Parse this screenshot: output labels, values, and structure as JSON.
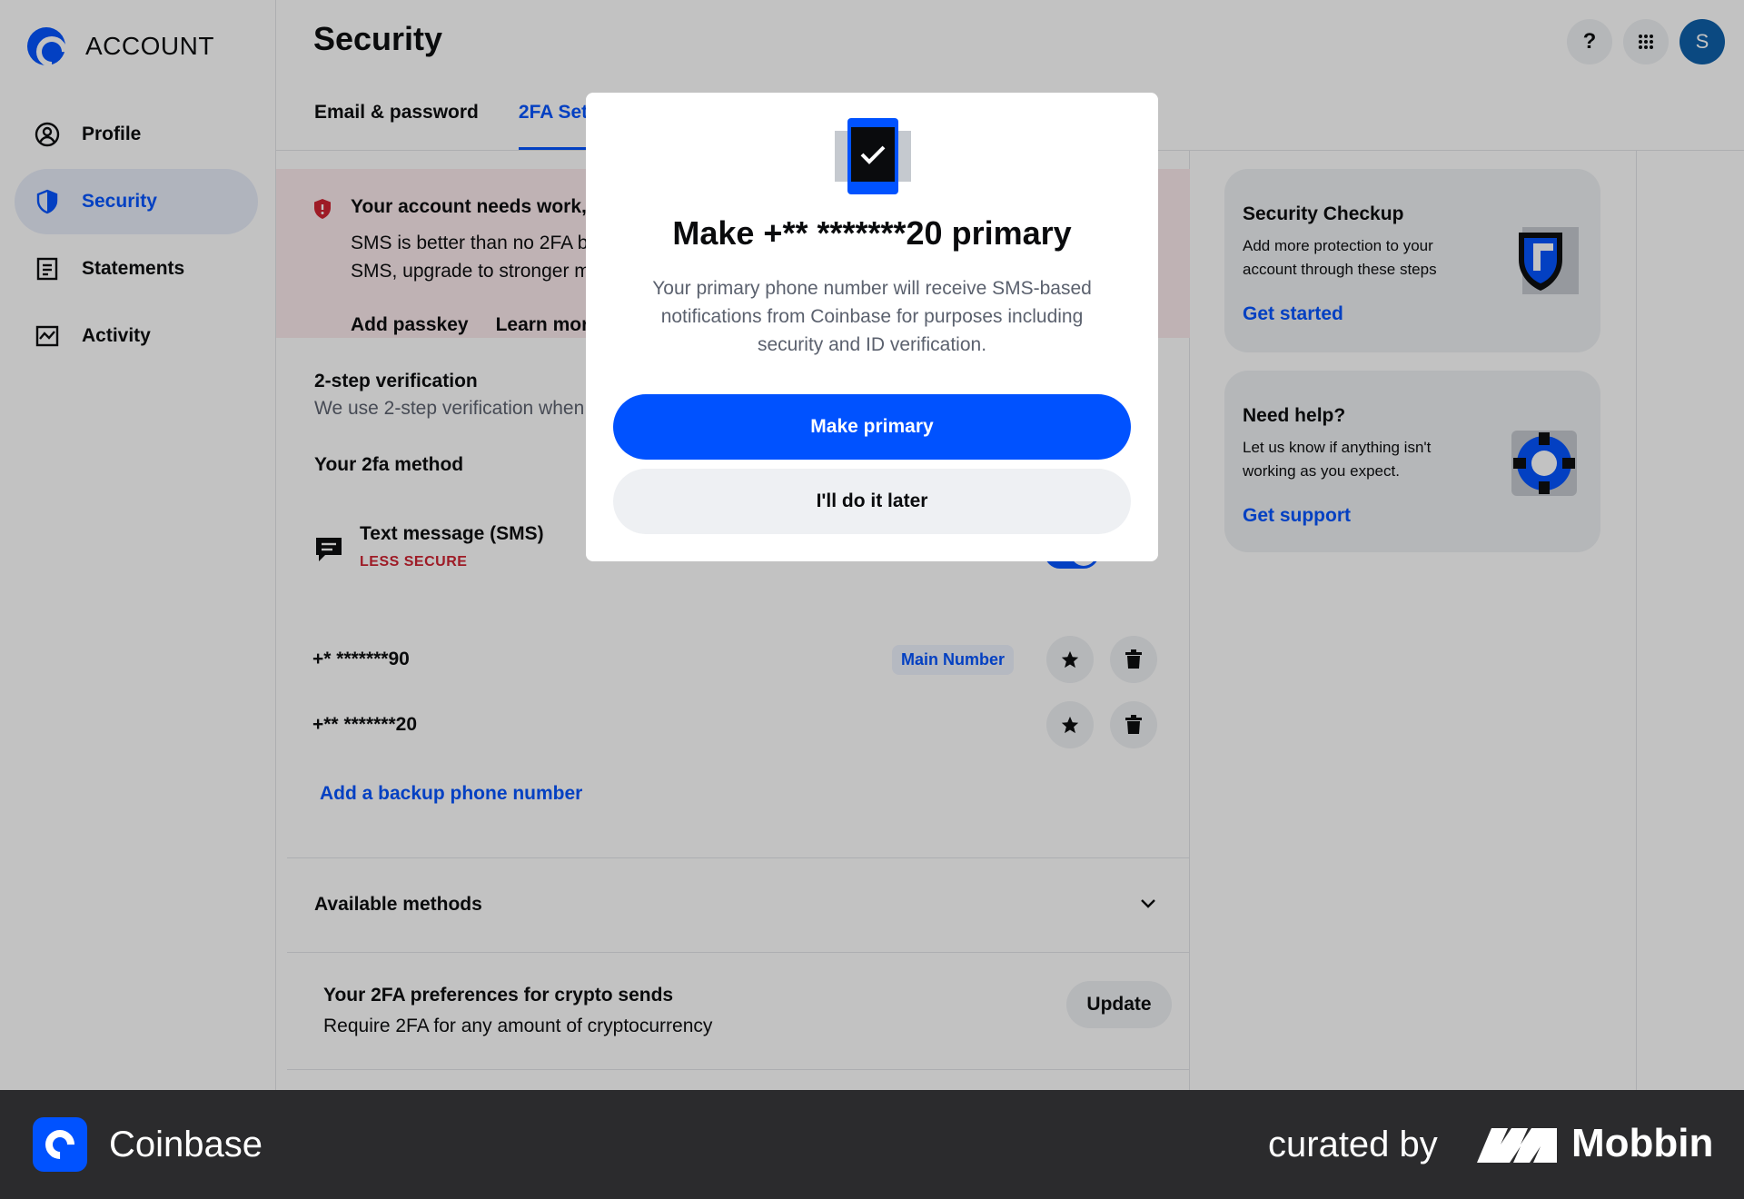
{
  "brand": {
    "name": "ACCOUNT"
  },
  "sidebar": {
    "items": [
      {
        "label": "Profile",
        "icon": "user-circle-icon"
      },
      {
        "label": "Security",
        "icon": "shield-icon"
      },
      {
        "label": "Statements",
        "icon": "document-icon"
      },
      {
        "label": "Activity",
        "icon": "chart-activity-icon"
      }
    ]
  },
  "header": {
    "title": "Security",
    "help_label": "?",
    "avatar_initial": "S"
  },
  "tabs": [
    {
      "label": "Email & password"
    },
    {
      "label": "2FA Settings"
    }
  ],
  "alert": {
    "title": "Your account needs work,",
    "body_line1": "SMS is better than no 2FA but",
    "body_line2": "SMS, upgrade to stronger methods",
    "link1": "Add passkey",
    "link2": "Learn more"
  },
  "two_step": {
    "title": "2-step verification",
    "subtitle": "We use 2-step verification when",
    "method_heading": "Your 2fa method",
    "method_name": "Text message (SMS)",
    "method_badge": "LESS SECURE"
  },
  "phones": [
    {
      "number": "+* *******90",
      "badge": "Main Number"
    },
    {
      "number": "+** *******20",
      "badge": ""
    }
  ],
  "add_backup_label": "Add a backup phone number",
  "available_methods_label": "Available methods",
  "preferences": {
    "title": "Your 2FA preferences for crypto sends",
    "subtitle": "Require 2FA for any amount of cryptocurrency",
    "button": "Update"
  },
  "cards": [
    {
      "title": "Security Checkup",
      "body": "Add more protection to your account through these steps",
      "link": "Get started"
    },
    {
      "title": "Need help?",
      "body": "Let us know if anything isn't working as you expect.",
      "link": "Get support"
    }
  ],
  "modal": {
    "title": "Make +** *******20 primary",
    "body": "Your primary phone number will receive SMS-based notifications from Coinbase for purposes including security and ID verification.",
    "primary_button": "Make primary",
    "secondary_button": "I'll do it later"
  },
  "footer": {
    "app_name": "Coinbase",
    "curated": "curated by",
    "mobbin": "Mobbin"
  },
  "colors": {
    "accent": "#0052ff",
    "danger": "#cf202f",
    "alert_bg": "#fbeaec"
  }
}
